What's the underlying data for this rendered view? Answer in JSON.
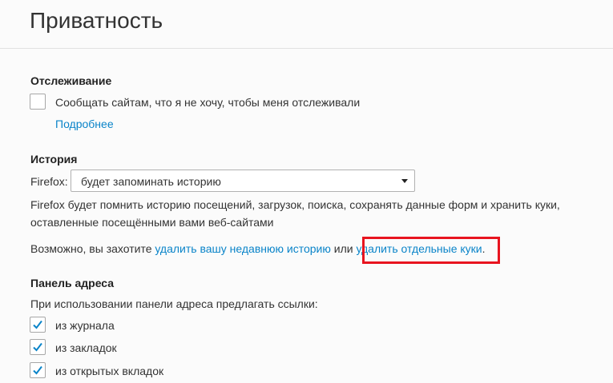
{
  "page": {
    "title": "Приватность"
  },
  "tracking": {
    "heading": "Отслеживание",
    "dnt_label": "Сообщать сайтам, что я не хочу, чтобы меня отслеживали",
    "dnt_checked": false,
    "learn_more": "Подробнее"
  },
  "history": {
    "heading": "История",
    "select_prefix": "Firefox:",
    "select_value": "будет запоминать историю",
    "desc_line1": "Firefox будет помнить историю посещений, загрузок, поиска, сохранять данные форм и хранить куки,",
    "desc_line2": "оставленные посещёнными вами веб-сайтами",
    "maybe_prefix": "Возможно, вы захотите ",
    "clear_recent_link": "удалить вашу недавнюю историю",
    "or_text": " или ",
    "remove_cookies_link": "удалить отдельные куки",
    "period": "."
  },
  "address_bar": {
    "heading": "Панель адреса",
    "desc": "При использовании панели адреса предлагать ссылки:",
    "options": [
      {
        "label": "из журнала",
        "checked": true
      },
      {
        "label": "из закладок",
        "checked": true
      },
      {
        "label": "из открытых вкладок",
        "checked": true
      }
    ]
  },
  "colors": {
    "link": "#0a84c9",
    "highlight": "#e8141f",
    "check": "#0a84c9"
  }
}
